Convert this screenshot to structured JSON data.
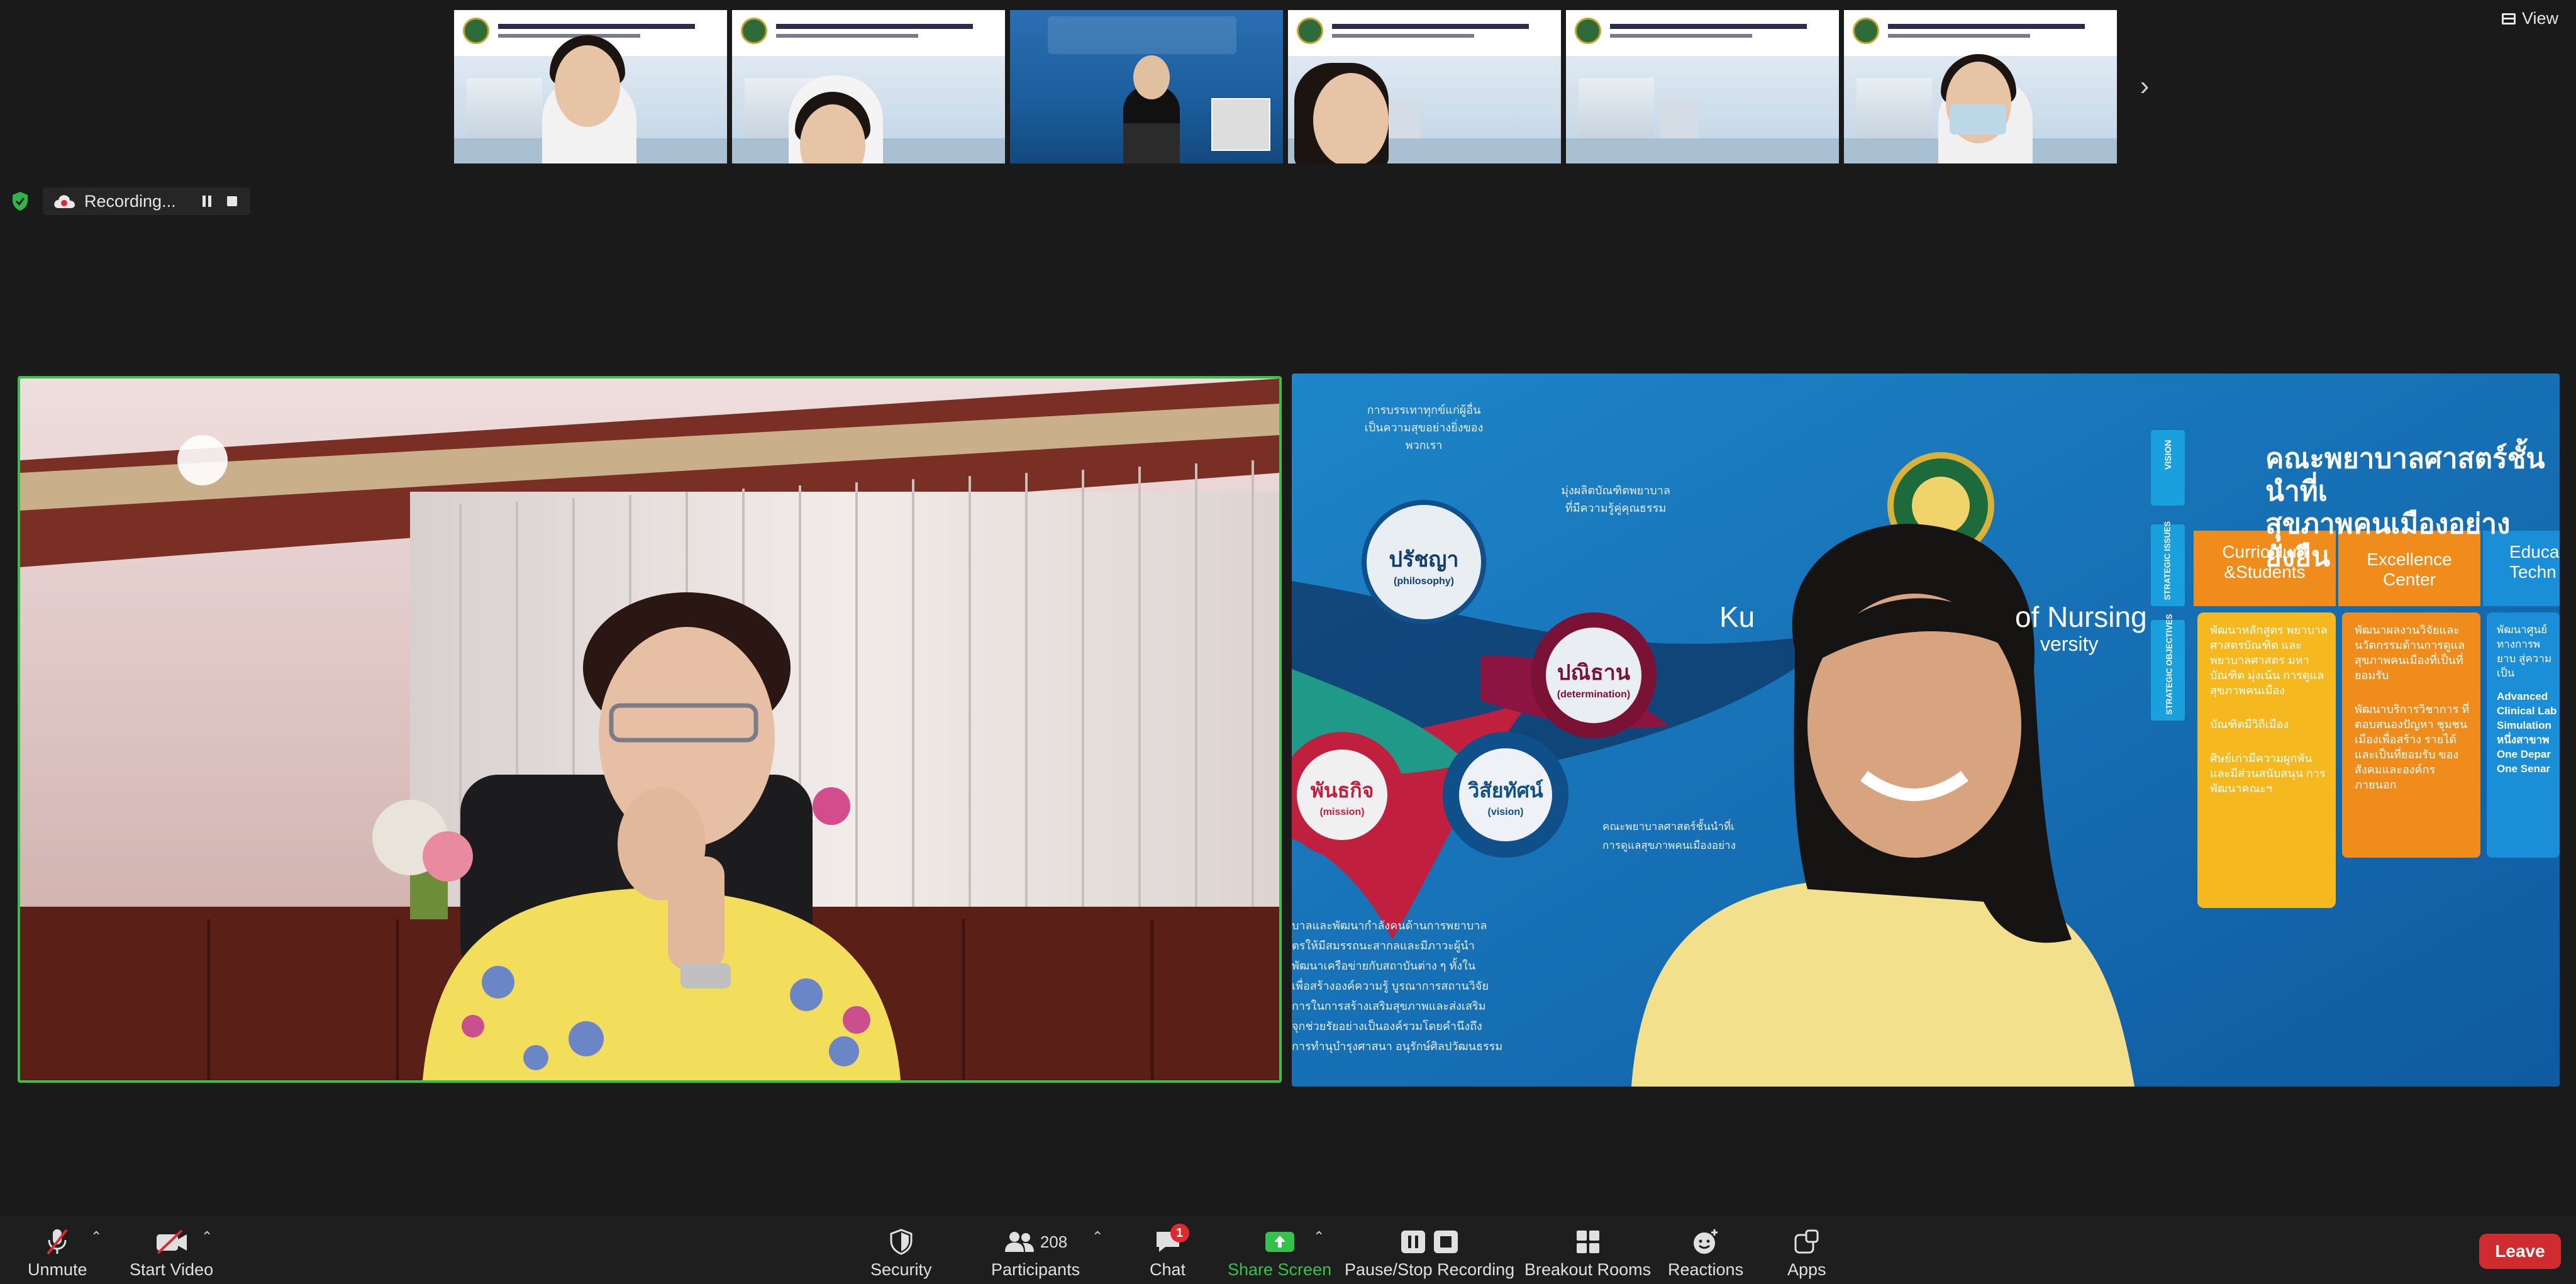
{
  "top_bar": {
    "view_label": "View"
  },
  "recording": {
    "label": "Recording..."
  },
  "thumbnails": [
    {
      "id": "t1",
      "type": "participant"
    },
    {
      "id": "t2",
      "type": "participant"
    },
    {
      "id": "t3",
      "type": "speaker"
    },
    {
      "id": "t4",
      "type": "participant"
    },
    {
      "id": "t5",
      "type": "participant"
    },
    {
      "id": "t6",
      "type": "participant"
    }
  ],
  "slide": {
    "title_line1": "คณะพยาบาลศาสตร์ชั้นนำที่เ",
    "title_line2": "สุขภาพคนเมืองอย่างยั่งยืน",
    "vision_tab": "VISION",
    "strategic_issues_tab": "STRATEGIC ISSUES",
    "strategic_objectives_tab": "STRATEGIC OBJECTIVES",
    "nursing_text_1": "Ku",
    "nursing_text_2": "of Nursing",
    "nursing_text_3": "versity",
    "col1": "Curriculum &Students",
    "col2": "Excellence Center",
    "col3": "Educa Techn",
    "circle_philosophy_th": "ปรัชญา",
    "circle_philosophy_en": "(philosophy)",
    "circle_determination_th": "ปณิธาน",
    "circle_determination_en": "(determination)",
    "circle_mission_th": "พันธกิจ",
    "circle_mission_en": "(mission)",
    "circle_vision_th": "วิสัยทัศน์",
    "circle_vision_en": "(vision)",
    "top_caption_1": "การบรรเทาทุกข์แก่ผู้อื่น",
    "top_caption_2": "เป็นความสุขอย่างยิ่งของพวกเรา",
    "mid_caption_1": "มุ่งผลิตบัณฑิตพยาบาล",
    "mid_caption_2": "ที่มีความรู้คู่คุณธรรม",
    "vision_caption_1": "คณะพยาบาลศาสตร์ชั้นนำที่เ",
    "vision_caption_2": "การดูแลสุขภาพคนเมืองอย่าง",
    "col1_items": [
      "พัฒนาหลักสูตร พยาบาลศาสตรบัณฑิต และพยาบาลศาสตร มหาบัณฑิต มุ่งเน้น การดูแลสุขภาพคนเมือง",
      "บัณฑิตมีวิถีเมือง",
      "ศิษย์เก่ามีความผูกพัน และมีส่วนสนับสนุน การพัฒนาคณะฯ"
    ],
    "col2_items": [
      "พัฒนาผลงานวิจัยและ นวัตกรรมด้านการดูแล สุขภาพคนเมืองที่เป็นที่ ยอมรับ",
      "พัฒนาบริการวิชาการ ที่ตอบสนองปัญหา ชุมชนเมืองเพื่อสร้าง รายได้และเป็นที่ยอมรับ ของสังคมและองค์กร ภายนอก"
    ],
    "col3_items": [
      "พัฒนาศูนย์ ทางการพยาบ สู่ความเป็น",
      "Advanced Clinical Lab Simulation หนึ่งสาขาพ One Depar One Senar"
    ],
    "mission_text": [
      "บาลและพัฒนากำลังคนด้านการพยาบาล",
      "ตรให้มีสมรรถนะสากลและมีภาวะผู้นำ",
      "พัฒนาเครือข่ายกับสถาบันต่าง ๆ ทั้งใน",
      "เพื่อสร้างองค์ความรู้ บูรณาการสถานวิจัย",
      "การในการสร้างเสริมสุขภาพและส่งเสริม",
      "จุกช่วยรัยอย่างเป็นองค์รวมโดยคำนึงถึง",
      "การทำนุบำรุงศาสนา อนุรักษ์ศิลปวัฒนธรรม"
    ]
  },
  "toolbar": {
    "unmute_label": "Unmute",
    "start_video_label": "Start Video",
    "security_label": "Security",
    "participants_label": "Participants",
    "participants_count": "208",
    "chat_label": "Chat",
    "chat_badge": "1",
    "share_label": "Share Screen",
    "pause_stop_label": "Pause/Stop Recording",
    "breakout_label": "Breakout Rooms",
    "reactions_label": "Reactions",
    "apps_label": "Apps",
    "leave_label": "Leave"
  },
  "colors": {
    "active_speaker_border": "#35c24a",
    "share_green": "#35c24a",
    "leave_red": "#d02c2f",
    "badge_red": "#e0292c",
    "slide_blue": "#1a79c0",
    "slide_orange": "#f08c1c",
    "slide_gold": "#f5b91f"
  }
}
